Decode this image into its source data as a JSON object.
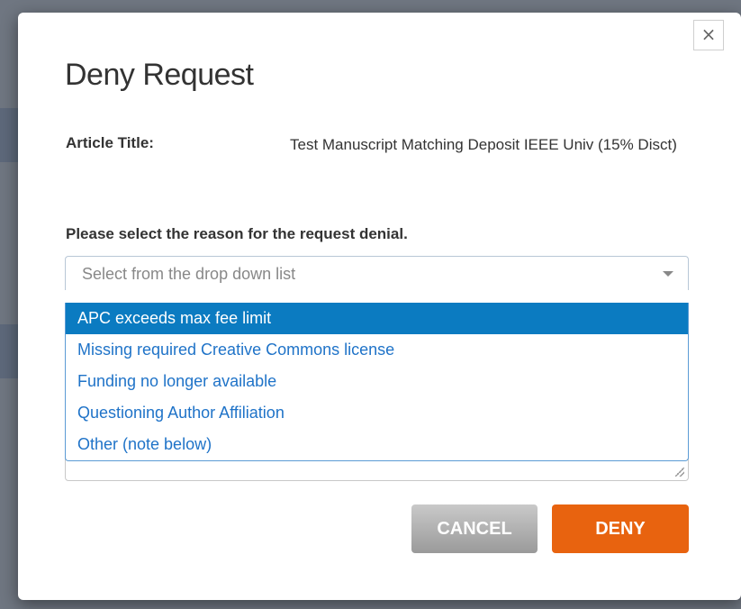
{
  "modal": {
    "title": "Deny Request",
    "close_label": "×",
    "article_label": "Article Title:",
    "article_value": "Test Manuscript Matching Deposit IEEE Univ (15% Disct)",
    "reason_prompt": "Please select the reason for the request denial.",
    "select": {
      "placeholder": "Select from the drop down list",
      "options": [
        "APC exceeds max fee limit",
        "Missing required Creative Commons license",
        "Funding no longer available",
        "Questioning Author Affiliation",
        "Other (note below)"
      ],
      "highlighted_index": 0
    },
    "buttons": {
      "cancel": "CANCEL",
      "deny": "DENY"
    }
  },
  "colors": {
    "accent_blue": "#0b7bc1",
    "option_text": "#1f73c8",
    "deny_orange": "#e8630f",
    "cancel_gray": "#a8a8a8"
  }
}
